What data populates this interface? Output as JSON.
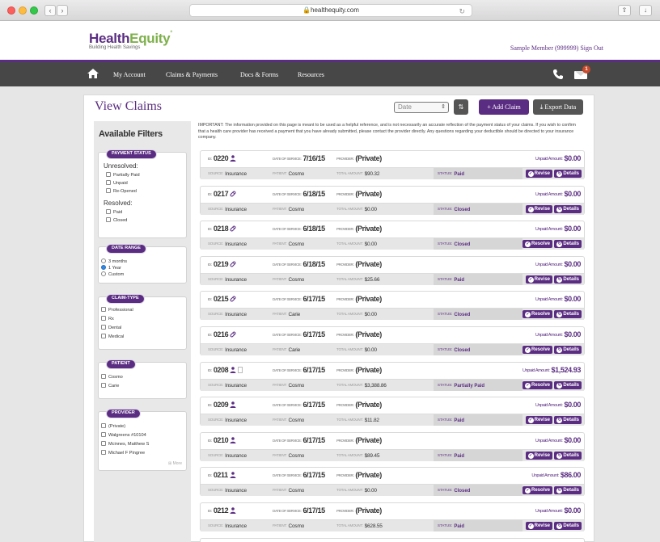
{
  "browser": {
    "url": "healthequity.com"
  },
  "header": {
    "logo_health": "Health",
    "logo_equity": "Equity",
    "logo_tagline": "Building Health Savings",
    "member_text": "Sample Member (999999) Sign Out"
  },
  "nav": {
    "items": [
      "My Account",
      "Claims & Payments",
      "Docs & Forms",
      "Resources"
    ],
    "mail_badge": "1"
  },
  "page": {
    "title": "View Claims",
    "sort_placeholder": "Date",
    "add_claim_label": "+ Add Claim",
    "export_label": "Export Data",
    "notice": "IMPORTANT: The information provided on this page is meant to be used as a helpful reference, and is not necessarily an accurate reflection of the payment status of your claims. If you wish to confirm that a health care provider has received a payment that you have already submitted, please contact the provider directly. Any questions regarding your deductible should be directed to your insurance company."
  },
  "filters": {
    "title": "Available Filters",
    "payment_status": {
      "label": "PAYMENT STATUS",
      "unresolved_label": "Unresolved:",
      "unresolved": [
        "Partially Paid",
        "Unpaid",
        "Re-Opened"
      ],
      "resolved_label": "Resolved:",
      "resolved": [
        "Paid",
        "Closed"
      ]
    },
    "date_range": {
      "label": "DATE RANGE",
      "options": [
        "3 months",
        "1 Year",
        "Custom"
      ],
      "selected": "1 Year"
    },
    "claim_type": {
      "label": "CLAIM-TYPE",
      "options": [
        "Professional",
        "Rx",
        "Dental",
        "Medical"
      ]
    },
    "patient": {
      "label": "PATIENT",
      "options": [
        "Cosmo",
        "Carie"
      ]
    },
    "provider": {
      "label": "PROVIDER",
      "options": [
        "(Private)",
        "Walgreens #10104",
        "Mcinnes, Matthew S",
        "Michael F Pingree"
      ],
      "more": "More"
    }
  },
  "labels": {
    "id": "ID:",
    "dos": "DATE OF SERVICE:",
    "provider": "PROVIDER:",
    "source": "SOURCE:",
    "patient": "PATIENT:",
    "total": "TOTAL AMOUNT:",
    "status": "STATUS:",
    "unpaid": "Unpaid Amount:",
    "revise": "Revise",
    "resolve": "Resolve",
    "details": "Details"
  },
  "claims": [
    {
      "id": "0220",
      "icon": "person",
      "dos": "7/16/15",
      "provider": "(Private)",
      "source": "Insurance",
      "patient": "Cosmo",
      "total": "$90.32",
      "status": "Paid",
      "unpaid": "$0.00",
      "action": "Revise"
    },
    {
      "id": "0217",
      "icon": "pill",
      "dos": "6/18/15",
      "provider": "(Private)",
      "source": "Insurance",
      "patient": "Cosmo",
      "total": "$0.00",
      "status": "Closed",
      "unpaid": "$0.00",
      "action": "Revise"
    },
    {
      "id": "0218",
      "icon": "pill",
      "dos": "6/18/15",
      "provider": "(Private)",
      "source": "Insurance",
      "patient": "Cosmo",
      "total": "$0.00",
      "status": "Closed",
      "unpaid": "$0.00",
      "action": "Resolve"
    },
    {
      "id": "0219",
      "icon": "pill",
      "dos": "6/18/15",
      "provider": "(Private)",
      "source": "Insurance",
      "patient": "Cosmo",
      "total": "$25.66",
      "status": "Paid",
      "unpaid": "$0.00",
      "action": "Revise"
    },
    {
      "id": "0215",
      "icon": "pill",
      "dos": "6/17/15",
      "provider": "(Private)",
      "source": "Insurance",
      "patient": "Carie",
      "total": "$0.00",
      "status": "Closed",
      "unpaid": "$0.00",
      "action": "Resolve"
    },
    {
      "id": "0216",
      "icon": "pill",
      "dos": "6/17/15",
      "provider": "(Private)",
      "source": "Insurance",
      "patient": "Carie",
      "total": "$0.00",
      "status": "Closed",
      "unpaid": "$0.00",
      "action": "Resolve"
    },
    {
      "id": "0208",
      "icon": "person-doc",
      "dos": "6/17/15",
      "provider": "(Private)",
      "source": "Insurance",
      "patient": "Cosmo",
      "total": "$3,388.86",
      "status": "Partially Paid",
      "unpaid": "$1,524.93",
      "action": "Resolve"
    },
    {
      "id": "0209",
      "icon": "person",
      "dos": "6/17/15",
      "provider": "(Private)",
      "source": "Insurance",
      "patient": "Cosmo",
      "total": "$11.82",
      "status": "Paid",
      "unpaid": "$0.00",
      "action": "Revise"
    },
    {
      "id": "0210",
      "icon": "person",
      "dos": "6/17/15",
      "provider": "(Private)",
      "source": "Insurance",
      "patient": "Cosmo",
      "total": "$89.45",
      "status": "Paid",
      "unpaid": "$0.00",
      "action": "Revise"
    },
    {
      "id": "0211",
      "icon": "person",
      "dos": "6/17/15",
      "provider": "(Private)",
      "source": "Insurance",
      "patient": "Cosmo",
      "total": "$0.00",
      "status": "Closed",
      "unpaid": "$86.00",
      "action": "Resolve"
    },
    {
      "id": "0212",
      "icon": "person",
      "dos": "6/17/15",
      "provider": "(Private)",
      "source": "Insurance",
      "patient": "Cosmo",
      "total": "$628.55",
      "status": "Paid",
      "unpaid": "$0.00",
      "action": "Revise"
    }
  ],
  "colors": {
    "brand_purple": "#5b2d82",
    "brand_green": "#7db04a",
    "nav_bg": "#474747"
  }
}
